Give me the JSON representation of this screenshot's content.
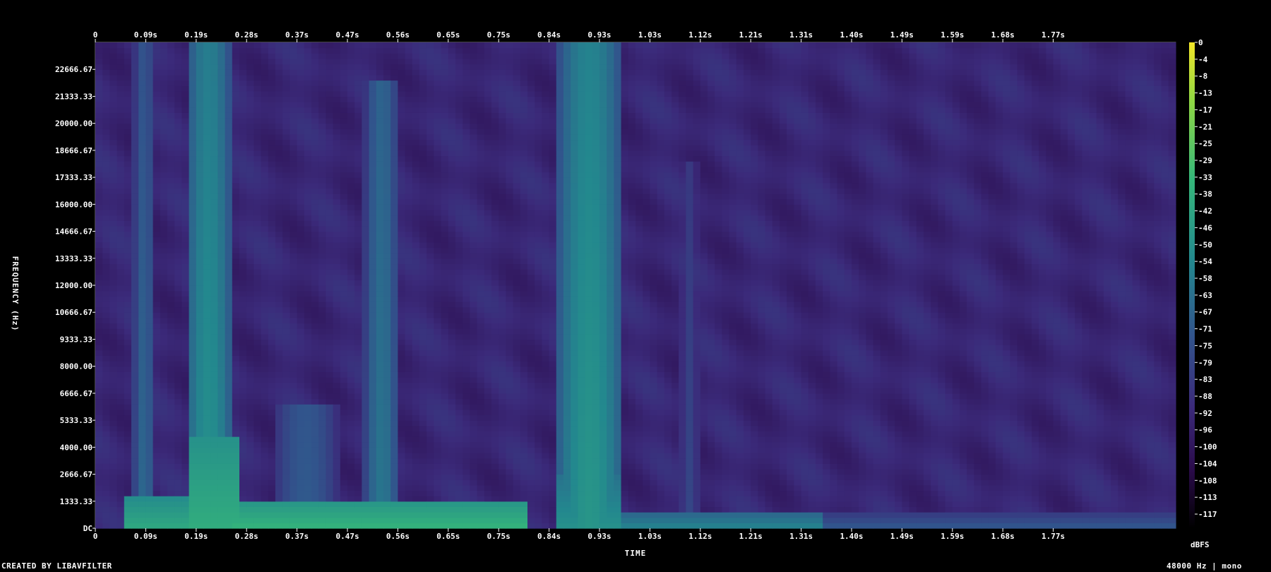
{
  "chart_data": {
    "type": "heatmap",
    "xlabel": "TIME",
    "ylabel": "FREQUENCY (Hz)",
    "x_unit": "s",
    "y_unit": "Hz",
    "xlim": [
      0,
      2.0
    ],
    "ylim": [
      0,
      24000
    ],
    "x_ticks": [
      "0",
      "0.09s",
      "0.19s",
      "0.28s",
      "0.37s",
      "0.47s",
      "0.56s",
      "0.65s",
      "0.75s",
      "0.84s",
      "0.93s",
      "1.03s",
      "1.12s",
      "1.21s",
      "1.31s",
      "1.40s",
      "1.49s",
      "1.59s",
      "1.68s",
      "1.77s"
    ],
    "x_tick_values": [
      0,
      0.0933,
      0.1867,
      0.28,
      0.3733,
      0.4667,
      0.56,
      0.6533,
      0.7467,
      0.84,
      0.9333,
      1.0267,
      1.12,
      1.2133,
      1.3067,
      1.4,
      1.4933,
      1.5867,
      1.68,
      1.7733
    ],
    "y_ticks": [
      "DC",
      "1333.33",
      "2666.67",
      "4000.00",
      "5333.33",
      "6666.67",
      "8000.00",
      "9333.33",
      "10666.67",
      "12000.00",
      "13333.33",
      "14666.67",
      "16000.00",
      "17333.33",
      "18666.67",
      "20000.00",
      "21333.33",
      "22666.67"
    ],
    "y_tick_values": [
      0,
      1333.33,
      2666.67,
      4000,
      5333.33,
      6666.67,
      8000,
      9333.33,
      10666.67,
      12000,
      13333.33,
      14666.67,
      16000,
      17333.33,
      18666.67,
      20000,
      21333.33,
      22666.67
    ],
    "colorbar": {
      "label": "dBFS",
      "ticks": [
        "0",
        "-4",
        "-8",
        "-13",
        "-17",
        "-21",
        "-25",
        "-29",
        "-33",
        "-38",
        "-42",
        "-46",
        "-50",
        "-54",
        "-58",
        "-63",
        "-67",
        "-71",
        "-75",
        "-79",
        "-83",
        "-88",
        "-92",
        "-96",
        "-100",
        "-104",
        "-108",
        "-113",
        "-117"
      ],
      "range": [
        -120,
        0
      ]
    },
    "background_level_db": -92,
    "bursts": [
      {
        "t_start": 0.07,
        "t_end": 0.11,
        "f_max": 24000,
        "level_db": -65
      },
      {
        "t_start": 0.17,
        "t_end": 0.25,
        "f_max": 24000,
        "level_db": -50
      },
      {
        "t_start": 0.33,
        "t_end": 0.45,
        "f_max": 6000,
        "level_db": -70
      },
      {
        "t_start": 0.5,
        "t_end": 0.56,
        "f_max": 22000,
        "level_db": -60
      },
      {
        "t_start": 0.86,
        "t_end": 0.97,
        "f_max": 24000,
        "level_db": -48
      },
      {
        "t_start": 1.08,
        "t_end": 1.12,
        "f_max": 18000,
        "level_db": -78
      }
    ],
    "low_band_energy": [
      {
        "t_start": 0.06,
        "t_end": 0.17,
        "f_max": 1500,
        "level_db": -40
      },
      {
        "t_start": 0.17,
        "t_end": 0.26,
        "f_max": 4500,
        "level_db": -38
      },
      {
        "t_start": 0.26,
        "t_end": 0.8,
        "f_max": 1200,
        "level_db": -35
      },
      {
        "t_start": 0.86,
        "t_end": 0.97,
        "f_max": 2600,
        "level_db": -50
      },
      {
        "t_start": 0.97,
        "t_end": 1.35,
        "f_max": 800,
        "level_db": -55
      },
      {
        "t_start": 1.35,
        "t_end": 2.0,
        "f_max": 700,
        "level_db": -70
      }
    ]
  },
  "footer": {
    "credit": "CREATED BY LIBAVFILTER",
    "info": "48000 Hz | mono"
  }
}
